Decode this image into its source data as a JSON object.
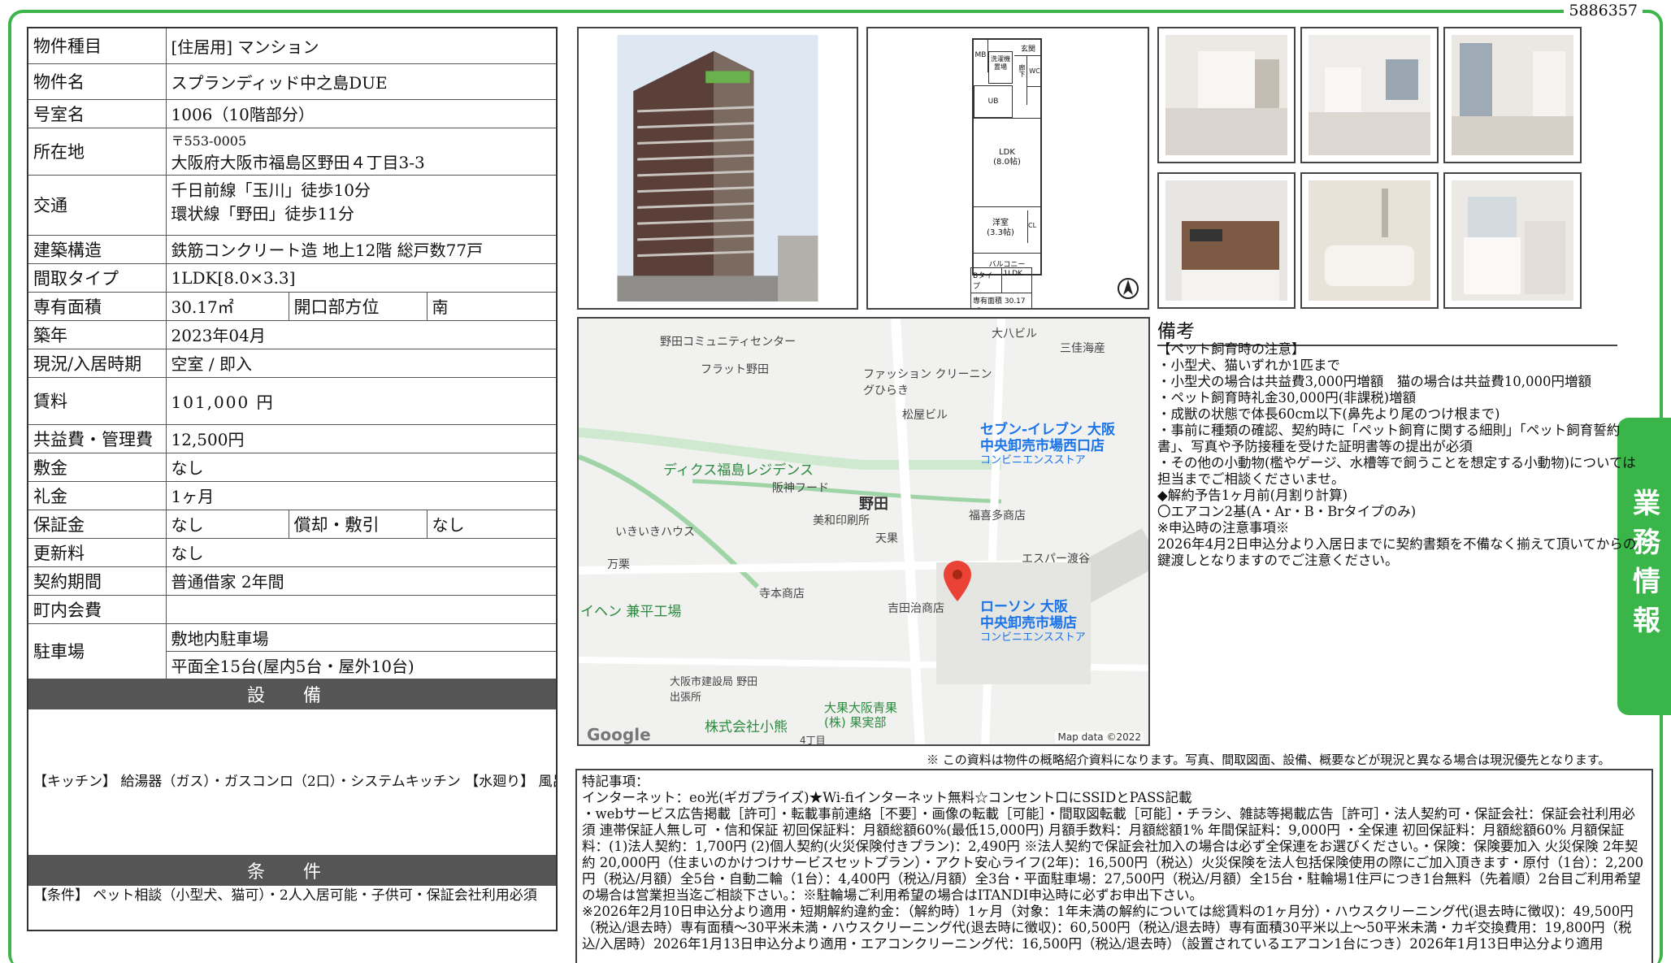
{
  "doc_id": "5886357",
  "side_tab": "業務情報",
  "rows": {
    "shubetsu": {
      "k": "物件種目",
      "v": "[住居用]  マンション"
    },
    "name": {
      "k": "物件名",
      "v": "スプランディッド中之島DUE"
    },
    "room": {
      "k": "号室名",
      "v": "1006（10階部分）"
    },
    "address": {
      "k": "所在地",
      "zip": "〒553-0005",
      "v": "大阪府大阪市福島区野田４丁目3-3"
    },
    "traffic": {
      "k": "交通",
      "v1": "千日前線「玉川」徒歩10分",
      "v2": "環状線「野田」徒歩11分"
    },
    "structure": {
      "k": "建築構造",
      "v": "鉄筋コンクリート造 地上12階 総戸数77戸"
    },
    "layout": {
      "k": "間取タイプ",
      "v": "1LDK[8.0×3.3]"
    },
    "area": {
      "k": "専有面積",
      "v": "30.17㎡",
      "k2": "開口部方位",
      "v2": "南"
    },
    "built": {
      "k": "築年",
      "v": "2023年04月"
    },
    "status": {
      "k": "現況/入居時期",
      "v": "空室 / 即入"
    },
    "rent": {
      "k": "賃料",
      "v": "101,000 円"
    },
    "kanri": {
      "k": "共益費・管理費",
      "v": "12,500円"
    },
    "shikikin": {
      "k": "敷金",
      "v": "なし"
    },
    "reikin": {
      "k": "礼金",
      "v": "1ヶ月"
    },
    "hoshokin": {
      "k": "保証金",
      "v": "なし",
      "k2": "償却・敷引",
      "v2": "なし"
    },
    "koshin": {
      "k": "更新料",
      "v": "なし"
    },
    "keiyaku": {
      "k": "契約期間",
      "v": "普通借家 2年間"
    },
    "chokai": {
      "k": "町内会費",
      "v": ""
    },
    "parking": {
      "k": "駐車場",
      "v1": "敷地内駐車場",
      "v2": "平面全15台(屋内5台・屋外10台)"
    }
  },
  "setsubi": {
    "title": "設 備",
    "text": "【キッチン】 給湯器（ガス）・ガスコンロ（2口）・システムキッチン 【水廻り】 風呂（ユニットバス）・トイレ（水洗）・洗面台（独立）・暖房便座・追い焚き・洗髪洗面化粧台・バス・トイレ別・洗濯機置場（室内） 【冷暖房】 エアコン（冷暖房） 【収納】 シューズボックス 【放送・通信】 インターネット対応・ネット使用料不要・Wi-Fi 【セキュリティ】 オートロック・宅配BOX・防犯カメラ・インターホン 【その他】 専用ごみ置場・エレベーター（1基）・オートバイ駐輪場・自転車置場・電気・ガス（都市ガス）・水道（公営）・排水（公共下水）・バルコニー／ベランダ"
  },
  "joken": {
    "title": "条 件",
    "text": "【条件】 ペット相談（小型犬、猫可）・2人入居可能・子供可・保証会社利用必須"
  },
  "floorplan": {
    "ldk": "LDK\n(8.0帖)",
    "yoshitsu": "洋室\n(3.3帖)",
    "balcony": "バルコニー",
    "type": "Bタイプ",
    "madori": "1LDK",
    "menseki": "専有面積 30.17㎡",
    "genkan": "玄関",
    "rouka": "廊下",
    "wc": "WC",
    "ub": "UB",
    "wash": "洗濯機置場",
    "mb": "MB",
    "cl": "CL"
  },
  "map": {
    "labels": [
      "野田コミュニティセンター",
      "大八ビル",
      "三佳海産",
      "フラット野田",
      "ファッション クリーニングひらき",
      "松屋ビル",
      "セブン-イレブン 大阪",
      "中央卸売市場西口店",
      "コンビニエンスストア",
      "ディクス福島レジデンス",
      "阪神フード",
      "野田",
      "福喜多商店",
      "美和印刷所",
      "いきいきハウス",
      "天果",
      "エスパー渡谷",
      "万栗",
      "寺本商店",
      "イヘン 兼平工場",
      "吉田治商店",
      "ローソン 大阪",
      "中央卸売市場店",
      "コンビニエンスストア",
      "大阪市建設局 野田出張所",
      "株式会社小熊",
      "大果大阪青果 (株) 果実部",
      "4丁目"
    ],
    "google": "Google",
    "credit": "Map data ©2022"
  },
  "bikou": {
    "title": "備考",
    "text": "【ペット飼育時の注意】\n・小型犬、猫いずれか1匹まで\n・小型犬の場合は共益費3,000円増額　猫の場合は共益費10,000円増額\n・ペット飼育時礼金30,000円(非課税)増額\n・成獣の状態で体長60cm以下(鼻先より尾のつけ根まで)\n・事前に種類の確認、契約時に「ペット飼育に関する細則」「ペット飼育誓約書」、写真や予防接種を受けた証明書等の提出が必須\n・その他の小動物(檻やゲージ、水槽等で飼うことを想定する小動物)については担当までご相談くださいませ。\n◆解約予告1ヶ月前(月割り計算)\n〇エアコン2基(A・Ar・B・Brタイプのみ)\n※申込時の注意事項※\n2026年4月2日申込分より入居日までに契約書類を不備なく揃えて頂いてからの鍵渡しとなりますのでご注意ください。"
  },
  "disclaimer": "※ この資料は物件の概略紹介資料になります。写真、間取図面、設備、概要などが現況と異なる場合は現況優先となります。",
  "tokki": {
    "text": "特記事項：\nインターネット：eo光(ギガプライズ)★Wi-fiインターネット無料☆コンセント口にSSIDとPASS記載\n・webサービス広告掲載［許可］・転載事前連絡［不要］・画像の転載［可能］・間取図転載［可能］・チラシ、雑誌等掲載広告［許可］・法人契約可・保証会社：保証会社利用必須 連帯保証人無し可 ・信和保証 初回保証料：月額総額60%(最低15,000円) 月額手数料：月額総額1% 年間保証料：9,000円 ・全保連 初回保証料：月額総額60% 月額保証料：(1)法人契約：1,700円 (2)個人契約(火災保険付きプラン)：2,490円 ※法人契約で保証会社加入の場合は必ず全保連をお選びください。・保険：保険要加入 火災保険 2年契約 20,000円（住まいのかけつけサービスセットプラン）・アクト安心ライフ(2年)：16,500円（税込）火災保険を法人包括保険使用の際にご加入頂きます・原付（1台）：2,200円（税込/月額）全5台・自動二輪（1台）：4,400円（税込/月額）全3台・平面駐車場：27,500円（税込/月額）全15台・駐輪場1住戸につき1台無料（先着順）2台目ご利用希望の場合は営業担当迄ご相談下さい。：※駐輪場ご利用希望の場合はITANDI申込時に必ずお申出下さい。\n※2026年2月10日申込分より適用・短期解約違約金：（解約時）1ヶ月（対象：1年未満の解約については総賃料の1ヶ月分）・ハウスクリーニング代(退去時に徴収)：49,500円（税込/退去時）専有面積〜30平米未満・ハウスクリーニング代(退去時に徴収)：60,500円（税込/退去時）専有面積30平米以上〜50平米未満・カギ交換費用：19,800円（税込/入居時）2026年1月13日申込分より適用・エアコンクリーニング代：16,500円（税込/退去時）（設置されているエアコン1台につき）2026年1月13日申込分より適用"
  }
}
